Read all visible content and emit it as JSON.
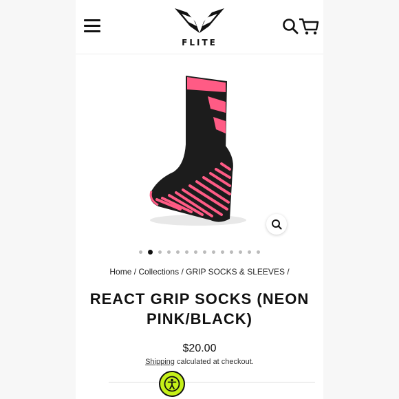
{
  "header": {
    "logo_text": "FLITE",
    "menu_icon": "hamburger-menu-icon",
    "search_icon": "search-icon",
    "cart_icon": "cart-icon"
  },
  "gallery": {
    "image_alt": "React Grip Socks (Neon Pink/Black)",
    "zoom_icon": "zoom-icon",
    "slide_count": 14,
    "active_slide": 2
  },
  "breadcrumb": {
    "items": [
      "Home",
      "Collections",
      "GRIP SOCKS & SLEEVES"
    ],
    "separator": "/"
  },
  "product": {
    "title": "REACT GRIP SOCKS (NEON PINK/BLACK)",
    "price": "$20.00",
    "shipping_link": "Shipping",
    "shipping_rest": " calculated at checkout."
  },
  "colors": {
    "accent_pink": "#ff5b85",
    "sock_black": "#1c1c1c",
    "accessibility_green": "#c5f018"
  },
  "accessibility": {
    "icon": "accessibility-person-icon"
  }
}
